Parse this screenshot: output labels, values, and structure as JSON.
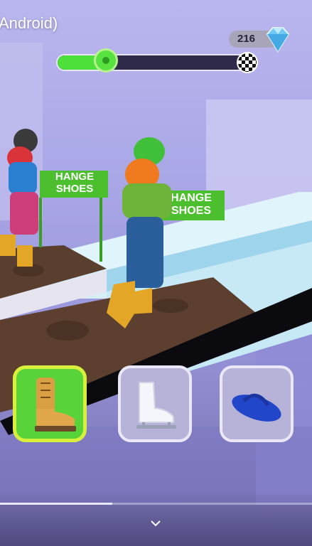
{
  "video": {
    "title": "Android)",
    "progress": 0.36
  },
  "hud": {
    "gem_count": "216",
    "gem_icon": "diamond-icon",
    "level_progress": 0.13,
    "finish_icon": "checkered-flag-icon"
  },
  "signs": [
    {
      "line1": "HANGE",
      "line2": "SHOES"
    },
    {
      "line1": "HANGE",
      "line2": "SHOES"
    }
  ],
  "shoe_options": [
    {
      "name": "boot",
      "icon": "boot-icon",
      "selected": true
    },
    {
      "name": "ice-skate",
      "icon": "ice-skate-icon",
      "selected": false
    },
    {
      "name": "flip-flop",
      "icon": "flip-flop-icon",
      "selected": false
    }
  ],
  "controls": {
    "collapse_icon": "chevron-down-icon"
  },
  "colors": {
    "accent_green": "#58d43a",
    "selected_border": "#d8f03c",
    "track_dark": "#2f2a4a",
    "sign_green": "#4cbf2e"
  }
}
